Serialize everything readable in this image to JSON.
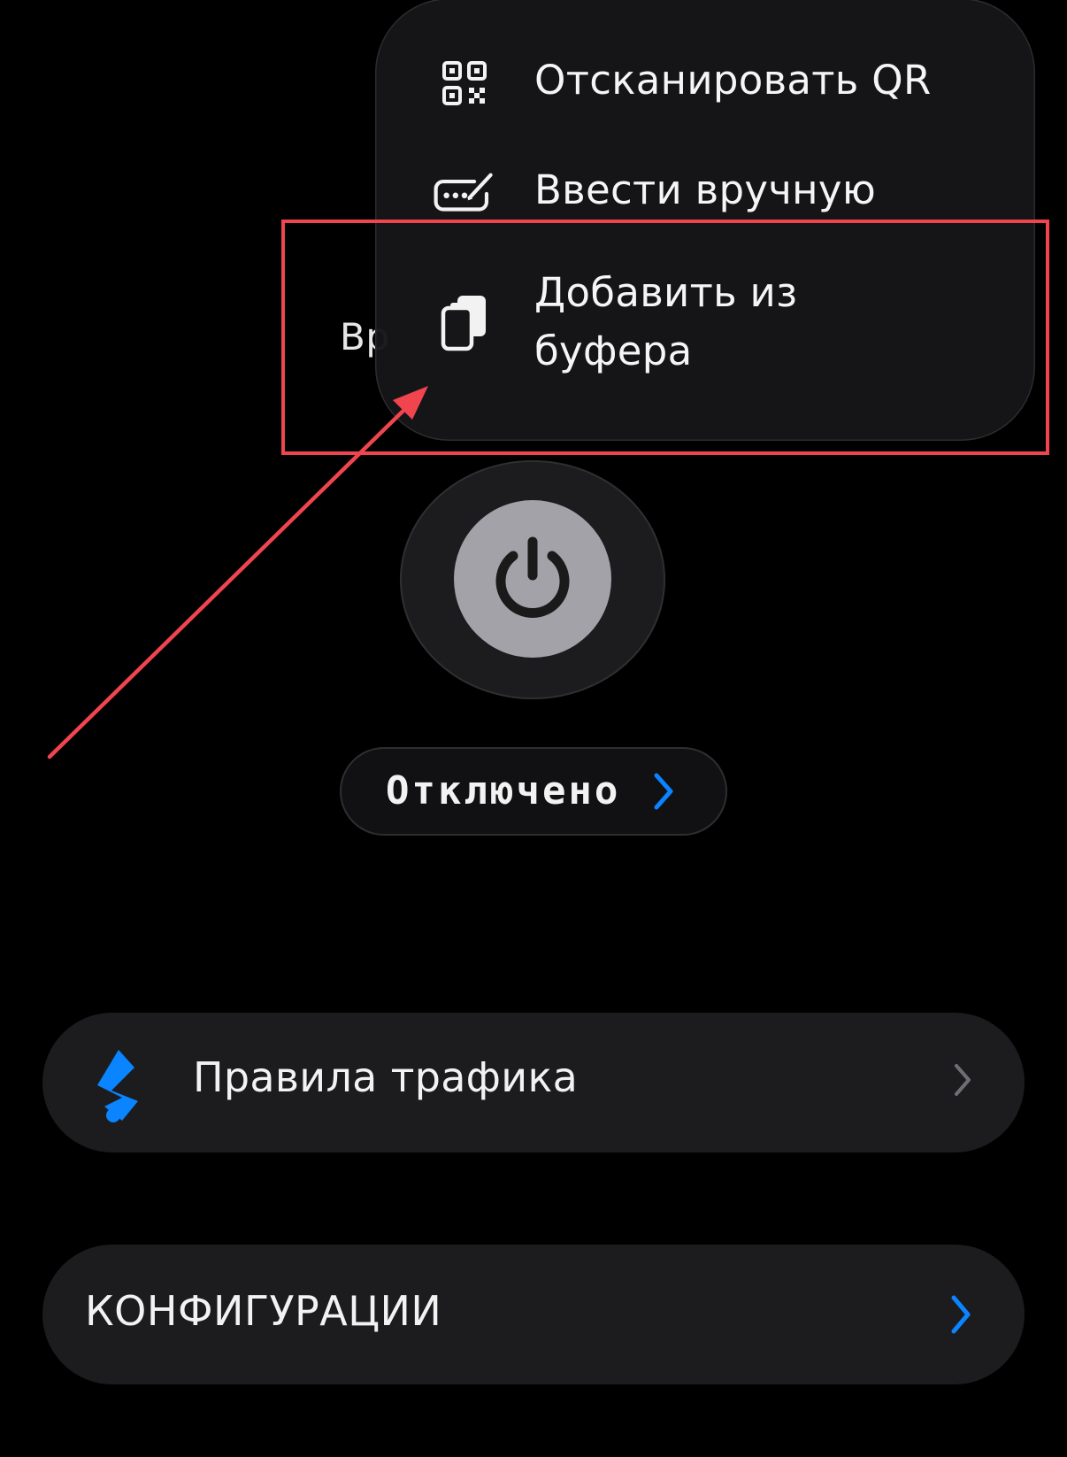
{
  "background": {
    "partial_label": "Вр"
  },
  "menu": {
    "items": [
      {
        "label": "Отсканировать QR",
        "icon": "qr-code-icon"
      },
      {
        "label": "Ввести вручную",
        "icon": "keyboard-pencil-icon"
      },
      {
        "label": "Добавить из\nбуфера",
        "icon": "clipboard-icon"
      }
    ]
  },
  "annotation": {
    "color": "#f0454e"
  },
  "power": {
    "icon": "power-icon",
    "state_color": "#a3a2a8"
  },
  "status": {
    "label": "Отключено",
    "chevron_color": "#0a84ff"
  },
  "cards": {
    "rules": {
      "label": "Правила трафика",
      "icon": "traffic-rules-icon",
      "icon_color": "#0a84ff"
    },
    "configs": {
      "label": "КОНФИГУРАЦИИ",
      "chevron_color": "#0a84ff"
    }
  },
  "colors": {
    "accent": "#0a84ff",
    "background": "#000000",
    "card": "#1c1c1e"
  }
}
